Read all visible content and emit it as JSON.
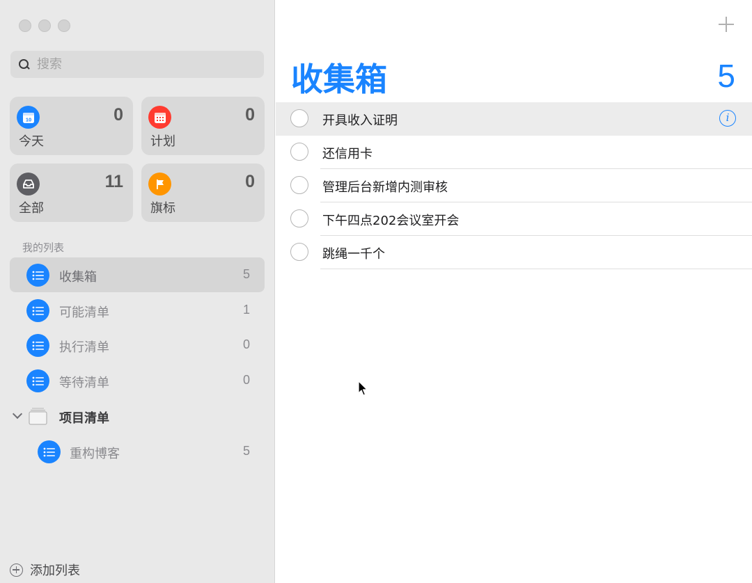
{
  "search": {
    "placeholder": "搜索"
  },
  "smart_lists": [
    {
      "label": "今天",
      "count": "0",
      "icon": "calendar-today-icon",
      "color": "#1a84ff"
    },
    {
      "label": "计划",
      "count": "0",
      "icon": "calendar-scheduled-icon",
      "color": "#ff3b30"
    },
    {
      "label": "全部",
      "count": "11",
      "icon": "tray-icon",
      "color": "#5e5e63"
    },
    {
      "label": "旗标",
      "count": "0",
      "icon": "flag-icon",
      "color": "#ff9500"
    }
  ],
  "today_icon_day": "10",
  "my_lists_title": "我的列表",
  "lists": [
    {
      "name": "收集箱",
      "count": "5"
    },
    {
      "name": "可能清单",
      "count": "1"
    },
    {
      "name": "执行清单",
      "count": "0"
    },
    {
      "name": "等待清单",
      "count": "0"
    }
  ],
  "group": {
    "name": "项目清单",
    "children": [
      {
        "name": "重构博客",
        "count": "5"
      }
    ]
  },
  "add_list_label": "添加列表",
  "main": {
    "title": "收集箱",
    "count": "5",
    "accent": "#1a84ff",
    "tasks": [
      {
        "title": "开具收入证明"
      },
      {
        "title": "还信用卡"
      },
      {
        "title": "管理后台新增内测审核"
      },
      {
        "title": "下午四点202会议室开会"
      },
      {
        "title": "跳绳一千个"
      }
    ]
  }
}
